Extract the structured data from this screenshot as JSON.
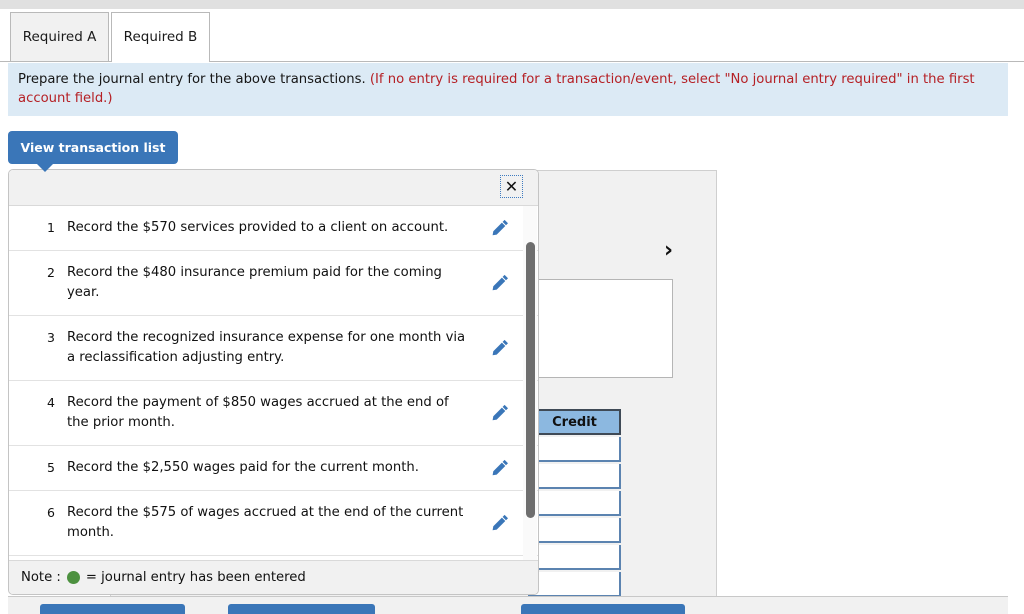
{
  "tabs": [
    {
      "label": "Required A",
      "active": false
    },
    {
      "label": "Required B",
      "active": true
    }
  ],
  "instruction": {
    "main": "Prepare the journal entry for the above transactions.",
    "hint": "(If no entry is required for a transaction/event, select \"No journal entry required\" in the first account field.)"
  },
  "toolbar": {
    "view_transaction_list_label": "View transaction list"
  },
  "popup": {
    "close_label": "✕",
    "close_icon": "close-icon",
    "edit_icon": "pencil-icon",
    "transactions": [
      {
        "num": "1",
        "text": "Record the $570 services provided to a client on account."
      },
      {
        "num": "2",
        "text": "Record the $480 insurance premium paid for the coming year."
      },
      {
        "num": "3",
        "text": "Record the recognized insurance expense for one month via a reclassification adjusting entry."
      },
      {
        "num": "4",
        "text": "Record the payment of $850 wages accrued at the end of the prior month."
      },
      {
        "num": "5",
        "text": "Record the $2,550 wages paid for the current month."
      },
      {
        "num": "6",
        "text": "Record the $575 of wages accrued at the end of the current month."
      }
    ],
    "note_prefix": "Note :",
    "note_suffix": "= journal entry has been entered",
    "note_dot_color": "#4d9140"
  },
  "worksheet": {
    "next_icon": "chevron-right-icon",
    "next_glyph": "›",
    "credit_header": "Credit",
    "credit_rows": [
      "",
      "",
      "",
      "",
      "",
      ""
    ]
  },
  "bottom_buttons": [
    {
      "label": ""
    },
    {
      "label": ""
    },
    {
      "label": ""
    }
  ],
  "colors": {
    "accent_blue": "#3a76b8",
    "banner_blue": "#dceaf5",
    "hint_red": "#b52025",
    "credit_header_blue": "#8cb8e0",
    "scrollbar_grey": "#6e6e6e"
  }
}
